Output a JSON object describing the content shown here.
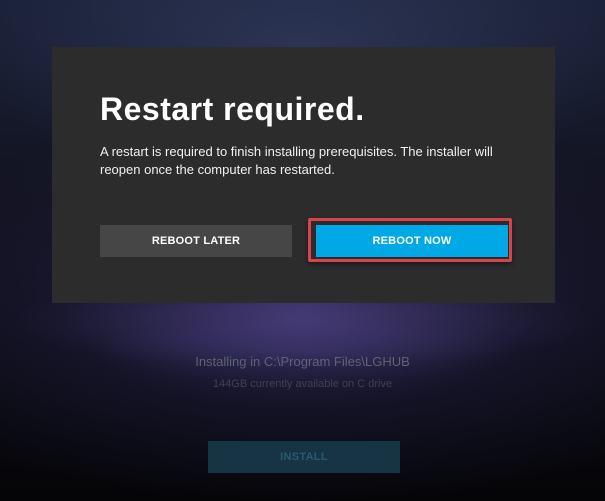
{
  "dialog": {
    "title": "Restart required.",
    "message": "A restart is required to finish installing prerequisites. The installer will reopen once the computer has restarted.",
    "reboot_later_label": "REBOOT LATER",
    "reboot_now_label": "REBOOT NOW"
  },
  "installer": {
    "install_path": "Installing in C:\\Program Files\\LGHUB",
    "drive_space": "144GB currently available on C drive",
    "install_label": "INSTALL"
  },
  "colors": {
    "accent": "#00a9e6",
    "highlight_border": "#d9434a",
    "dialog_background": "#2c2c2c",
    "secondary_button": "#464646"
  }
}
